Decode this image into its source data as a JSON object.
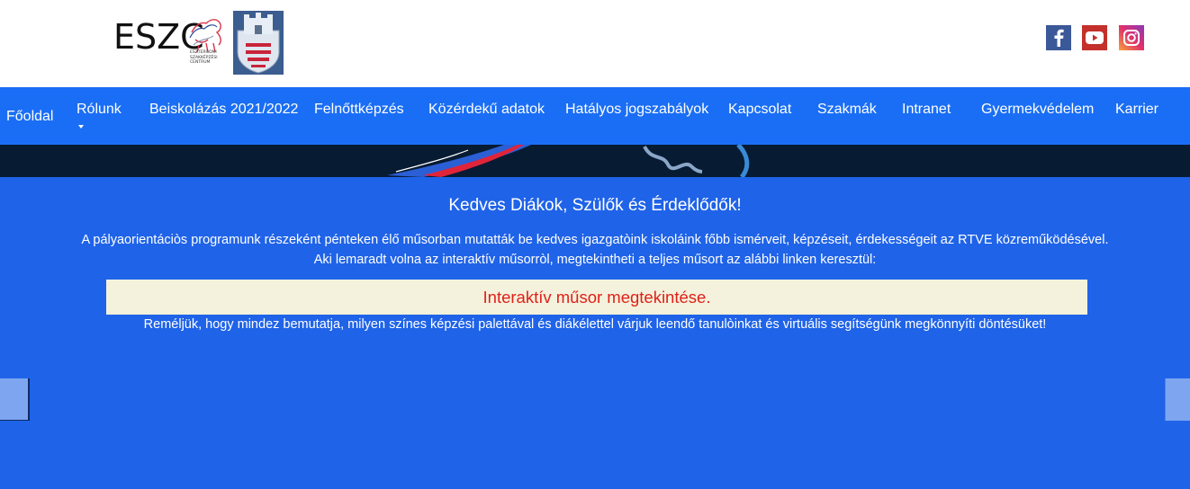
{
  "header": {
    "logo_text": "ESZC",
    "logo_sub": [
      "ESZTERGOMI",
      "SZAKKÉPZÉSI",
      "CENTRUM"
    ],
    "social": [
      "facebook-icon",
      "youtube-icon",
      "instagram-icon"
    ]
  },
  "nav": {
    "items": [
      "Főoldal",
      "Rólunk",
      "Beiskolázás 2021/2022",
      "Felnőttképzés",
      "Közérdekű adatok",
      "Hatályos jogszabályok",
      "Kapcsolat",
      "Szakmák",
      "Intranet",
      "Gyermekvédelem",
      "Karrier"
    ]
  },
  "content": {
    "heading": "Kedves Diákok, Szülők és Érdeklődők!",
    "paragraph1": "A pályaorientáciòs programunk részeként pénteken élő műsorban mutatták be kedves igazgatòink iskoláink főbb ismérveit, képzéseit, érdekességeit az RTVE közreműködésével.",
    "paragraph2": "Aki lemaradt volna az interaktív műsorròl, megtekintheti a teljes műsort az alábbi linken keresztül:",
    "link": "Interaktív műsor megtekintése.",
    "paragraph3": "Reméljük, hogy mindez bemutatja, milyen színes képzési palettával és diákélettel várjuk leendő tanulòinkat és virtuális segítségünk megkönnyíti döntésüket!"
  },
  "colors": {
    "nav_bg": "#1a6ef5",
    "content_bg": "#1f63e8",
    "link": "#e0201a",
    "link_box": "#f4f2dc"
  }
}
